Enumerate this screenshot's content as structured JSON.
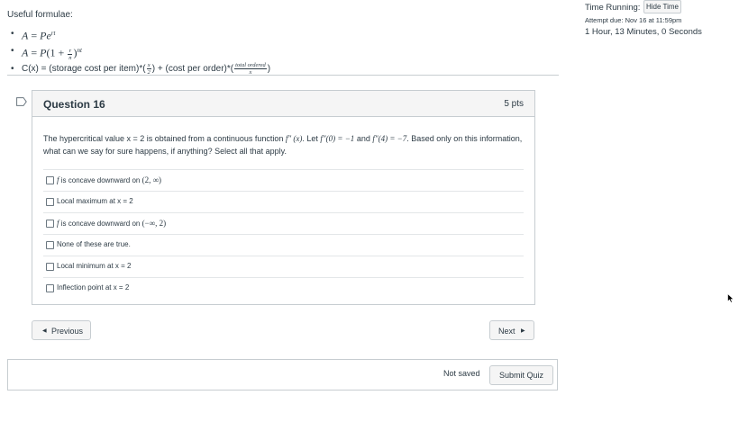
{
  "formulae": {
    "heading": "Useful formulae:",
    "f1": {
      "lhs": "A",
      "eq": " = ",
      "base": "Pe",
      "exp": "rt"
    },
    "f2": {
      "lhs": "A",
      "eq": " = ",
      "p": "P",
      "lparen": "(1 + ",
      "num": "r",
      "den": "n",
      "rparen": ")",
      "exp": "nt"
    },
    "f3": {
      "text_a": "C(x) = (storage cost per item)*(",
      "frac1_num": "x",
      "frac1_den": "2",
      "text_b": ") + (cost per order)*(",
      "frac2_num": "total ordered",
      "frac2_den": "x",
      "text_c": ")"
    }
  },
  "timer": {
    "label": "Time Running:",
    "hide_button": "Hide Time",
    "attempt_due": "Attempt due: Nov 16 at 11:59pm",
    "value": "1 Hour, 13 Minutes, 0 Seconds"
  },
  "question": {
    "title": "Question 16",
    "points": "5 pts",
    "text": {
      "p1": "The hypercritical value x = 2 is obtained from a continuous function ",
      "m1": "f″ (x)",
      "p2": ". Let ",
      "m2": "f″(0) = −1",
      "p3": " and ",
      "m3": "f″(4) = −7",
      "p4": ". Based only on this information, what can we say for sure happens, if anything? Select all that apply."
    },
    "answers": {
      "a1": {
        "f": "f",
        "t": " is concave downward on ",
        "m": "(2, ∞)"
      },
      "a2": {
        "t": "Local maximum at x = 2"
      },
      "a3": {
        "f": "f",
        "t": " is concave downward on ",
        "m": "(−∞, 2)"
      },
      "a4": {
        "t": "None of these are true."
      },
      "a5": {
        "t": "Local minimum at x = 2"
      },
      "a6": {
        "t": "Inflection point at x = 2"
      }
    }
  },
  "nav": {
    "previous_label": "Previous",
    "next_label": "Next",
    "prev_arrow": "◀",
    "next_arrow": "▶"
  },
  "submit": {
    "status": "Not saved",
    "button": "Submit Quiz"
  },
  "icons": {
    "flag": "bookmark-flag-icon",
    "cursor": "mouse-pointer-icon"
  },
  "colors": {
    "text": "#2d3b45",
    "border": "#c7cdd1",
    "header_bg": "#f5f5f5"
  }
}
